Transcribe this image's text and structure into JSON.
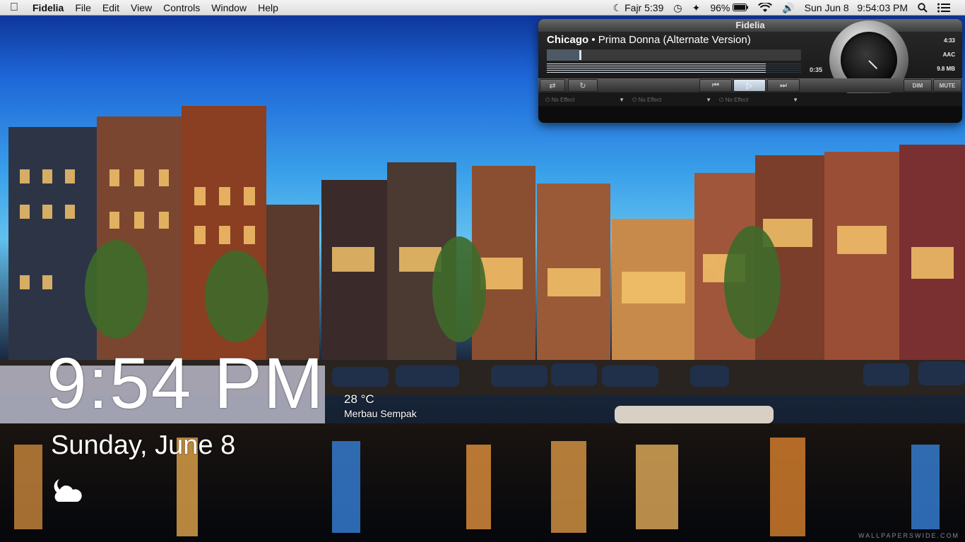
{
  "menubar": {
    "app_name": "Fidelia",
    "items": [
      "File",
      "Edit",
      "View",
      "Controls",
      "Window",
      "Help"
    ],
    "prayer": "Fajr 5:39",
    "battery": "96%",
    "datetime": "Sun Jun 8   9:54:03 PM"
  },
  "player": {
    "title": "Fidelia",
    "artist": "Chicago",
    "separator": " • ",
    "song": "Prima Donna (Alternate Version)",
    "elapsed": "0:35",
    "duration": "4:33",
    "format": "AAC",
    "size": "9.8 MB",
    "progress": 0.128,
    "level": 0.86,
    "dim_label": "DIM",
    "mute_label": "MUTE",
    "effects": [
      "No Effect",
      "No Effect",
      "No Effect"
    ]
  },
  "widget": {
    "time": "9:54 PM",
    "temperature": "28 °C",
    "location": "Merbau Sempak",
    "date": "Sunday, June 8"
  },
  "watermark": "WALLPAPERSWIDE.COM",
  "colors": {
    "menubar": "#e6e6e6",
    "player_bg": "#141414",
    "sky": "#2a86e4"
  }
}
